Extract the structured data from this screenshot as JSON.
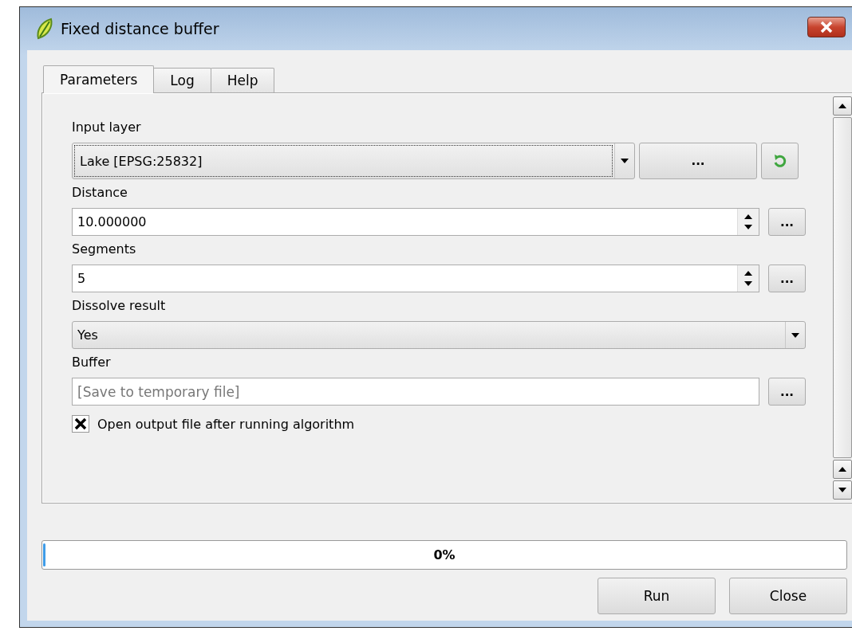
{
  "window": {
    "title": "Fixed distance buffer"
  },
  "tabs": [
    {
      "label": "Parameters",
      "selected": true
    },
    {
      "label": "Log",
      "selected": false
    },
    {
      "label": "Help",
      "selected": false
    }
  ],
  "parameters": [
    {
      "kind": "layer",
      "label": "Input layer",
      "value": "Lake [EPSG:25832]",
      "button": "..."
    },
    {
      "kind": "number",
      "label": "Distance",
      "value": "10.000000",
      "button": "..."
    },
    {
      "kind": "number",
      "label": "Segments",
      "value": "5",
      "button": "..."
    },
    {
      "kind": "select",
      "label": "Dissolve result",
      "value": "Yes"
    },
    {
      "kind": "output",
      "label": "Buffer",
      "placeholder": "[Save to temporary file]",
      "button": "..."
    }
  ],
  "open_output": {
    "label": "Open output file after running algorithm",
    "checked": true
  },
  "progress": {
    "level": 0,
    "reading": "0%"
  },
  "buttons": [
    "Run",
    "Close"
  ]
}
